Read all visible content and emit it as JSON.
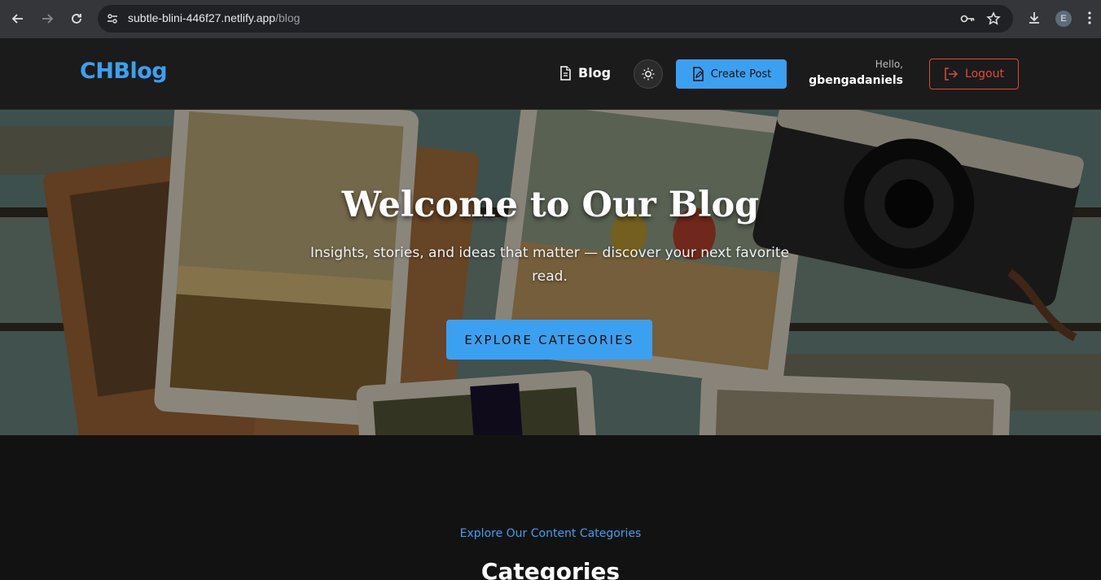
{
  "browser": {
    "url_host": "subtle-blini-446f27.netlify.app",
    "url_path": "/blog",
    "profile_initial": "E",
    "icons": [
      "back-arrow-icon",
      "forward-arrow-icon",
      "reload-icon",
      "site-settings-icon",
      "password-key-icon",
      "bookmark-star-icon",
      "download-icon",
      "more-menu-icon"
    ]
  },
  "header": {
    "logo": "CHBlog",
    "nav_blog_label": "Blog",
    "create_post_label": "Create Post",
    "greeting": "Hello,",
    "username": "gbengadaniels",
    "logout_label": "Logout",
    "accent_color": "#3ca0f0",
    "logout_color": "#e0493a"
  },
  "hero": {
    "title": "Welcome to Our Blog",
    "subtitle": "Insights, stories, and ideas that matter — discover your next favorite read.",
    "cta_label": "EXPLORE CATEGORIES"
  },
  "categories_section": {
    "kicker": "Explore Our Content Categories",
    "title": "Categories"
  }
}
